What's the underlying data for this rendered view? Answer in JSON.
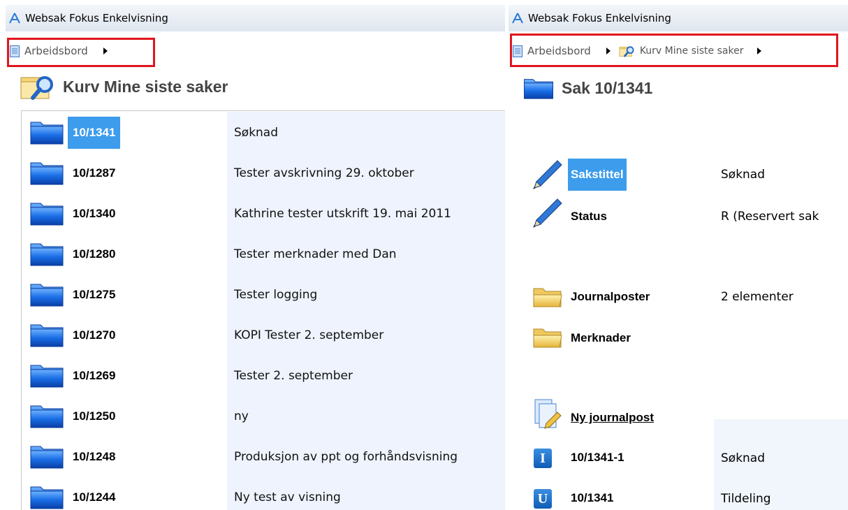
{
  "left": {
    "window_title": "Websak Fokus Enkelvisning",
    "breadcrumb": [
      "Arbeidsbord"
    ],
    "heading": "Kurv Mine siste saker",
    "cases": [
      {
        "id": "10/1341",
        "title": "Søknad",
        "selected": true
      },
      {
        "id": "10/1287",
        "title": "Tester avskrivning 29. oktober"
      },
      {
        "id": "10/1340",
        "title": "Kathrine tester utskrift 19. mai 2011"
      },
      {
        "id": "10/1280",
        "title": "Tester merknader med Dan"
      },
      {
        "id": "10/1275",
        "title": "Tester logging"
      },
      {
        "id": "10/1270",
        "title": "KOPI Tester 2. september"
      },
      {
        "id": "10/1269",
        "title": "Tester 2. september"
      },
      {
        "id": "10/1250",
        "title": "ny"
      },
      {
        "id": "10/1248",
        "title": "Produksjon av ppt og forhåndsvisning"
      },
      {
        "id": "10/1244",
        "title": "Ny test av visning"
      }
    ]
  },
  "right": {
    "window_title": "Websak Fokus Enkelvisning",
    "breadcrumb": [
      "Arbeidsbord",
      "Kurv Mine siste saker"
    ],
    "heading": "Sak 10/1341",
    "fields": {
      "sakstittel_label": "Sakstittel",
      "sakstittel_value": "Søknad",
      "status_label": "Status",
      "status_value": "R (Reservert sak"
    },
    "folders": {
      "journalposter_label": "Journalposter",
      "journalposter_value": "2 elementer",
      "merknader_label": "Merknader"
    },
    "new_entry_link": "Ny journalpost",
    "entries": [
      {
        "badge": "I",
        "id": "10/1341-1",
        "title": "Søknad"
      },
      {
        "badge": "U",
        "id": "10/1341",
        "title": "Tildeling"
      }
    ]
  },
  "colors": {
    "highlight_border": "#e0151e",
    "selection": "#3d9cec",
    "value_background": "#eef3fd"
  }
}
